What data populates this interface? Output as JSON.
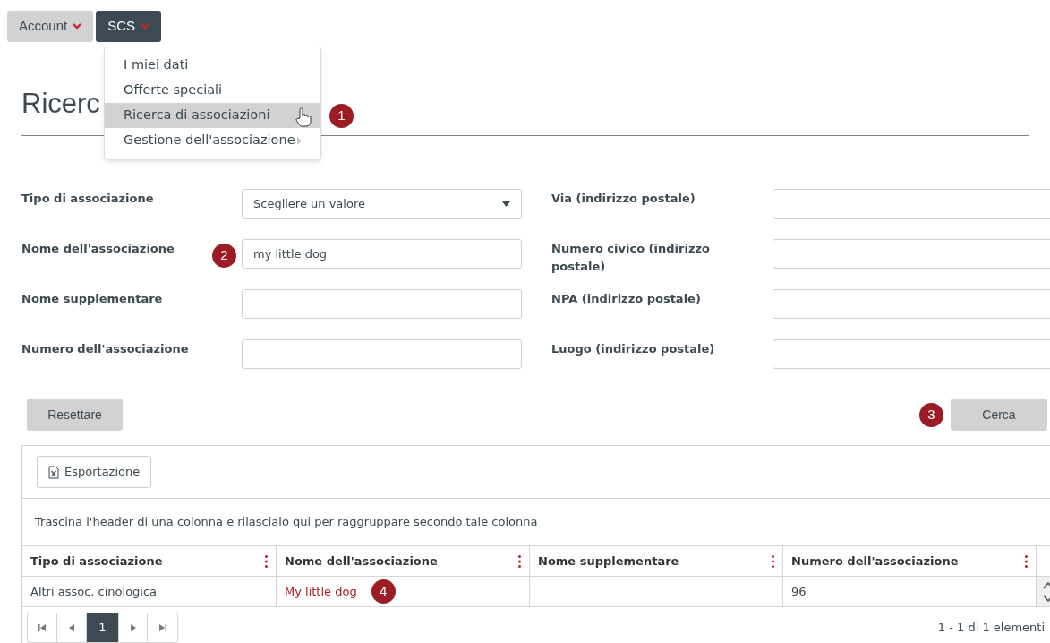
{
  "nav": [
    {
      "label": "Account",
      "selected": false
    },
    {
      "label": "SCS",
      "selected": true
    }
  ],
  "menu": {
    "items": [
      {
        "label": "I miei dati",
        "selected": false,
        "kind": "item"
      },
      {
        "label": "Offerte speciali",
        "selected": false,
        "kind": "item"
      },
      {
        "label": "Ricerca di associazioni",
        "selected": true,
        "kind": "item",
        "badge": "1"
      },
      {
        "label": "Gestione dell'associazione",
        "selected": false,
        "kind": "submenu"
      }
    ]
  },
  "page_title": "Ricerc",
  "form": {
    "left": [
      {
        "label": "Tipo di associazione",
        "kind": "select",
        "value": "Scegliere un valore"
      },
      {
        "label": "Nome dell'associazione",
        "kind": "text",
        "value": "my little dog",
        "badge": "2"
      },
      {
        "label": "Nome supplementare",
        "kind": "text"
      },
      {
        "label": "Numero dell'associazione",
        "kind": "text"
      }
    ],
    "right": [
      {
        "label": "Via (indirizzo postale)",
        "kind": "text"
      },
      {
        "label": "Numero civico (indirizzo postale)",
        "kind": "text"
      },
      {
        "label": "NPA (indirizzo postale)",
        "kind": "text"
      },
      {
        "label": "Luogo (indirizzo postale)",
        "kind": "text"
      }
    ]
  },
  "reset_button": "Resettare",
  "search_button": {
    "label": "Cerca",
    "badge": "3"
  },
  "grid": {
    "export_button": "Esportazione",
    "group_hint": "Trascina l'header di una colonna e rilascialo qui per raggruppare secondo tale colonna",
    "columns": [
      "Tipo di associazione",
      "Nome dell'associazione",
      "Nome supplementare",
      "Numero dell'associazione"
    ],
    "rows": [
      {
        "cells": [
          {
            "text": "Altri assoc. cinologica",
            "kind": "plain"
          },
          {
            "text": "My little dog",
            "kind": "link",
            "badge": "4"
          },
          {
            "text": "",
            "kind": "plain"
          },
          {
            "text": "96",
            "kind": "plain"
          }
        ]
      }
    ],
    "pager": {
      "pages": [
        {
          "label": "1",
          "selected": true
        }
      ],
      "summary": "1 - 1 di 1 elementi"
    }
  }
}
